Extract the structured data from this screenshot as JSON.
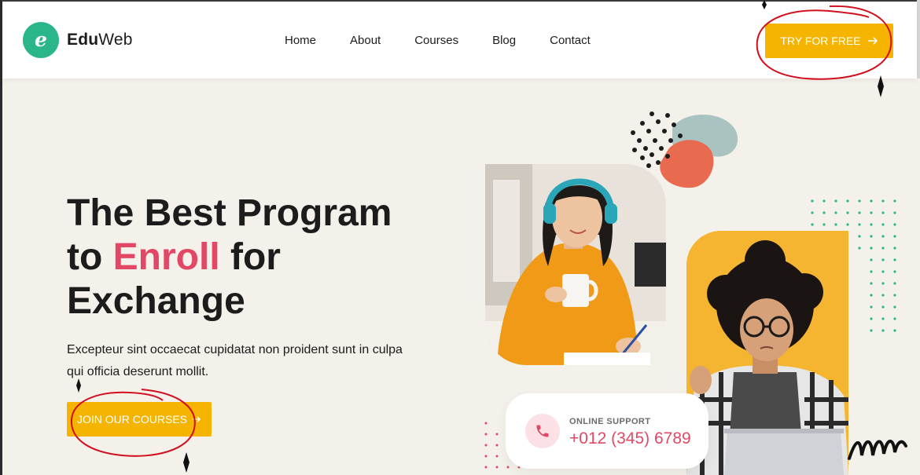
{
  "brand": {
    "name_bold": "Edu",
    "name_rest": "Web",
    "accent_color": "#2bb58b"
  },
  "nav": {
    "items": [
      {
        "label": "Home"
      },
      {
        "label": "About"
      },
      {
        "label": "Courses"
      },
      {
        "label": "Blog"
      },
      {
        "label": "Contact"
      }
    ]
  },
  "header": {
    "cta_label": "TRY FOR FREE",
    "cta_icon": "arrow-right-icon"
  },
  "hero": {
    "title_line1": "The Best Program",
    "title_line2_pre": "to ",
    "title_accent": "Enroll",
    "title_line2_post": " for",
    "title_line3": "Exchange",
    "description": "Excepteur sint occaecat cupidatat non proident sunt in culpa qui officia deserunt mollit.",
    "cta_label": "JOIN OUR COURSES",
    "cta_icon": "arrow-right-icon"
  },
  "support": {
    "label": "ONLINE SUPPORT",
    "phone": "+012 (345) 6789",
    "icon": "phone-icon"
  },
  "colors": {
    "primary_yellow": "#f5b400",
    "accent_pink": "#e24865",
    "background": "#f4f0ea",
    "coral": "#e86a4f",
    "sage": "#a9c4c0",
    "dot_green": "#2bb58b"
  }
}
